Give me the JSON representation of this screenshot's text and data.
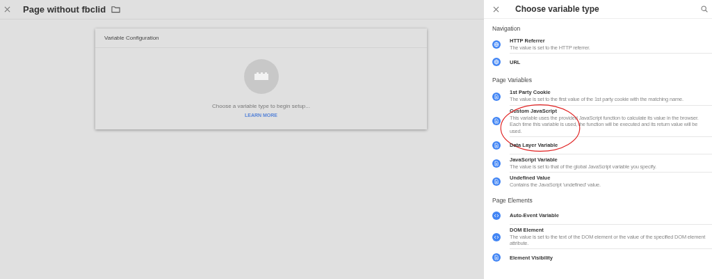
{
  "page": {
    "title": "Page without fbclid"
  },
  "config_card": {
    "title": "Variable Configuration",
    "prompt": "Choose a variable type to begin setup...",
    "link": "LEARN MORE"
  },
  "panel": {
    "title": "Choose variable type",
    "sections": [
      {
        "heading": "Navigation",
        "items": [
          {
            "kind": "globe",
            "title": "HTTP Referrer",
            "description": "The value is set to the HTTP referrer."
          },
          {
            "kind": "globe",
            "title": "URL"
          }
        ]
      },
      {
        "heading": "Page Variables",
        "items": [
          {
            "kind": "doc",
            "title": "1st Party Cookie",
            "description": "The value is set to the first value of the 1st party cookie with the matching name."
          },
          {
            "kind": "doc",
            "title": "Custom JavaScript",
            "description": "This variable uses the provided JavaScript function to calculate its value in the browser. Each time this variable is used, the function will be executed and its return value will be used.",
            "circled": true
          },
          {
            "kind": "doc",
            "title": "Data Layer Variable"
          },
          {
            "kind": "doc",
            "title": "JavaScript Variable",
            "description": "The value is set to that of the global JavaScript variable you specify."
          },
          {
            "kind": "doc",
            "title": "Undefined Value",
            "description": "Contains the JavaScript 'undefined' value."
          }
        ]
      },
      {
        "heading": "Page Elements",
        "items": [
          {
            "kind": "code",
            "title": "Auto-Event Variable"
          },
          {
            "kind": "code",
            "title": "DOM Element",
            "description": "The value is set to the text of the DOM element or the value of the specified DOM element attribute."
          },
          {
            "kind": "doc",
            "title": "Element Visibility"
          }
        ]
      }
    ]
  }
}
